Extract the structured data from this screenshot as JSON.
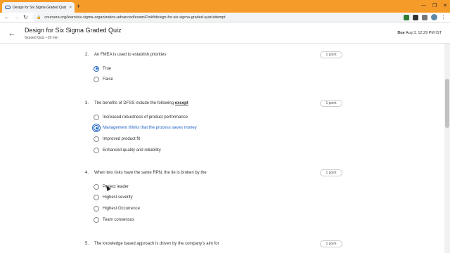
{
  "browser": {
    "tab_title": "Design for Six Sigma Graded Quiz",
    "tab_close": "×",
    "new_tab": "+",
    "url": "coursera.org/learn/six-sigma-organization-advanced/exam/Ftnkf/design-for-six-sigma-graded-quiz/attempt",
    "window_controls": [
      "—",
      "❐",
      "✕"
    ]
  },
  "header": {
    "title": "Design for Six Sigma Graded Quiz",
    "subtitle": "Graded Quiz • 20 min",
    "due_label": "Due",
    "due_value": "Aug 3, 12:29 PM IST"
  },
  "questions": [
    {
      "number": "2.",
      "text": "An FMEA is used to establish priorities",
      "points": "1 point",
      "options": [
        {
          "label": "True",
          "selected": true
        },
        {
          "label": "False",
          "selected": false
        }
      ]
    },
    {
      "number": "3.",
      "text_before": "The benefits of DFSS include the following ",
      "text_emph": "except",
      "points": "1 point",
      "options": [
        {
          "label": "Increased robustness of product performance",
          "selected": false
        },
        {
          "label": "Management thinks that the process saves money",
          "selected": true
        },
        {
          "label": "Improved product fit",
          "selected": false
        },
        {
          "label": "Enhanced quality and reliability",
          "selected": false
        }
      ]
    },
    {
      "number": "4.",
      "text": "When two risks have the same RPN, the tie is broken by the",
      "points": "1 point",
      "options": [
        {
          "label": "Project leader",
          "selected": false
        },
        {
          "label": "Highest severity",
          "selected": false
        },
        {
          "label": "Highest Occurrence",
          "selected": false
        },
        {
          "label": "Team consensus",
          "selected": false
        }
      ]
    },
    {
      "number": "5.",
      "text": "The knowledge based approach is driven by the company's aim for",
      "points": "1 point"
    }
  ]
}
